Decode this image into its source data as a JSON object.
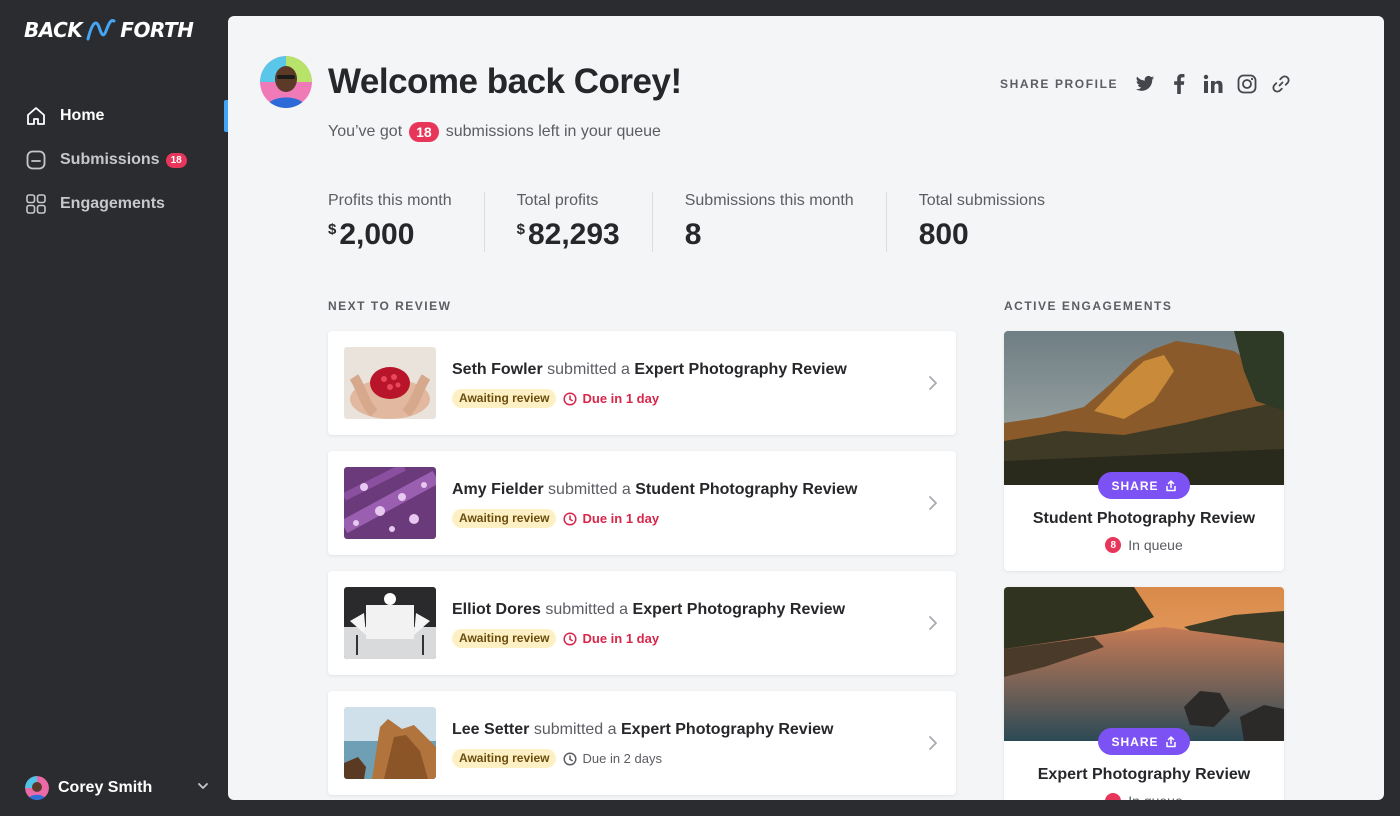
{
  "brand": {
    "left": "BACK",
    "right": "FORTH",
    "accent": "#45a5f5"
  },
  "nav": {
    "items": [
      {
        "label": "Home",
        "icon": "home-icon"
      },
      {
        "label": "Submissions",
        "icon": "folder-icon",
        "badge": "18"
      },
      {
        "label": "Engagements",
        "icon": "grid-icon"
      }
    ]
  },
  "user": {
    "name": "Corey Smith"
  },
  "header": {
    "welcome": "Welcome back Corey!",
    "queue_prefix": "You’ve got",
    "queue_count": "18",
    "queue_suffix": "submissions left in your queue",
    "share_label": "SHARE PROFILE",
    "social_icons": [
      "twitter-icon",
      "facebook-icon",
      "linkedin-icon",
      "instagram-icon",
      "link-icon"
    ]
  },
  "stats": [
    {
      "label": "Profits this month",
      "currency": "$",
      "value": "2,000"
    },
    {
      "label": "Total profits",
      "currency": "$",
      "value": "82,293"
    },
    {
      "label": "Submissions this month",
      "value": "8"
    },
    {
      "label": "Total submissions",
      "value": "800"
    }
  ],
  "next_to_review": {
    "title": "NEXT TO REVIEW",
    "connector": "submitted a",
    "items": [
      {
        "name": "Seth Fowler",
        "review": "Expert Photography Review",
        "status": "Awaiting review",
        "due": "Due in 1 day"
      },
      {
        "name": "Amy Fielder",
        "review": "Student Photography Review",
        "status": "Awaiting review",
        "due": "Due in 1 day"
      },
      {
        "name": "Elliot Dores",
        "review": "Expert Photography Review",
        "status": "Awaiting review",
        "due": "Due in 1 day"
      },
      {
        "name": "Lee Setter",
        "review": "Expert Photography Review",
        "status": "Awaiting review",
        "due": "Due in 2 days"
      }
    ]
  },
  "active_engagements": {
    "title": "ACTIVE ENGAGEMENTS",
    "share_label": "SHARE",
    "queue_label": "In queue",
    "items": [
      {
        "title": "Student Photography Review",
        "count": "8"
      },
      {
        "title": "Expert Photography Review",
        "count": ""
      }
    ]
  }
}
